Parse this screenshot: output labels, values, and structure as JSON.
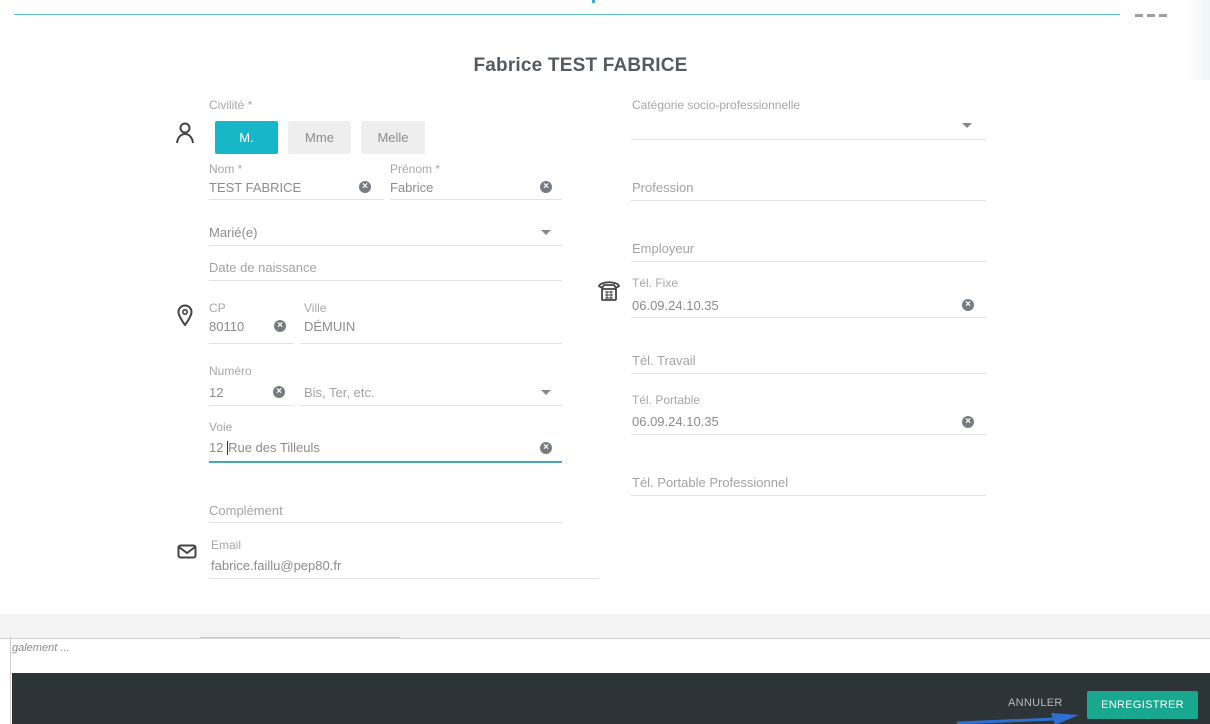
{
  "page_title": "Fabrice TEST FABRICE",
  "civilite": {
    "label": "Civilité *",
    "options": [
      "M.",
      "Mme",
      "Melle"
    ],
    "selected": "M."
  },
  "nom": {
    "label": "Nom *",
    "value": "TEST FABRICE"
  },
  "prenom": {
    "label": "Prénom *",
    "value": "Fabrice"
  },
  "situation": {
    "value": "Marié(e)"
  },
  "naissance": {
    "placeholder": "Date de naissance"
  },
  "cp": {
    "label": "CP",
    "value": "80110"
  },
  "ville": {
    "label": "Ville",
    "value": "DÉMUIN"
  },
  "numero": {
    "label": "Numéro",
    "value": "12"
  },
  "bis": {
    "placeholder": "Bis, Ter, etc."
  },
  "voie": {
    "label": "Voie",
    "value_before_cursor": "12 ",
    "value_after_cursor": "Rue des Tilleuls"
  },
  "complement": {
    "placeholder": "Complément"
  },
  "email": {
    "label": "Email",
    "value": "fabrice.faillu@pep80.fr"
  },
  "csp": {
    "label": "Catégorie socio-professionnelle"
  },
  "profession": {
    "placeholder": "Profession"
  },
  "employeur": {
    "placeholder": "Employeur"
  },
  "tel_fixe": {
    "label": "Tél. Fixe",
    "value": "06.09.24.10.35"
  },
  "tel_travail": {
    "placeholder": "Tél. Travail"
  },
  "tel_portable": {
    "label": "Tél. Portable",
    "value": "06.09.24.10.35"
  },
  "tel_portable_pro": {
    "placeholder": "Tél. Portable Professionnel"
  },
  "remarks_fragment": "galement ...",
  "footer": {
    "cancel_label": "ANNULER",
    "save_label": "ENREGISTRER"
  },
  "colors": {
    "accent": "#18b7c8",
    "save": "#19a88f",
    "footer_bg": "#2d3438"
  },
  "icons": [
    "person-icon",
    "location-pin-icon",
    "email-envelope-icon",
    "telephone-icon",
    "clear-icon",
    "caret-down-icon"
  ]
}
